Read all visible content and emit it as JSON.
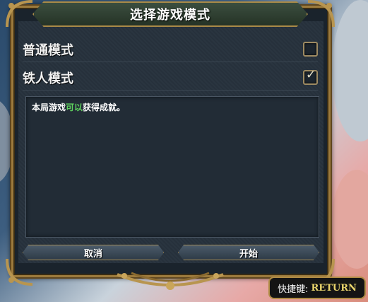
{
  "dialog": {
    "title": "选择游戏模式",
    "options": [
      {
        "label": "普通模式",
        "checked": false
      },
      {
        "label": "铁人模式",
        "checked": true
      }
    ],
    "info": {
      "prefix": "本局游戏",
      "highlight": "可以",
      "suffix": "获得成就。"
    },
    "buttons": {
      "cancel": "取消",
      "start": "开始"
    }
  },
  "hotkey": {
    "label": "快捷键:",
    "key": "RETURN"
  },
  "colors": {
    "highlight_green": "#5fd35f",
    "frame_gold": "#9c7a3c",
    "hotkey_yellow": "#e8d36b"
  },
  "icons": {
    "checkmark": "checkmark-icon",
    "corner": "ornate-corner-icon"
  }
}
